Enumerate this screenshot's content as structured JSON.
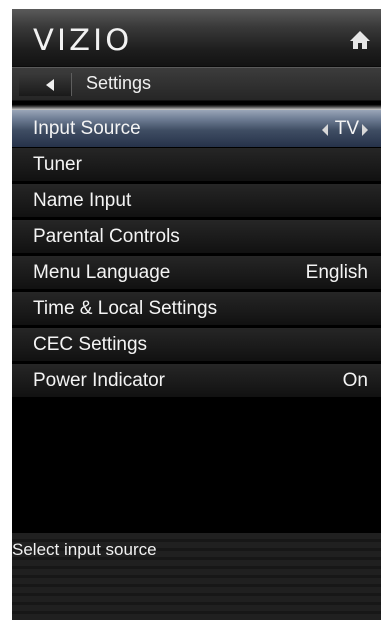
{
  "header": {
    "brand": "VIZIO",
    "home_icon": "home-icon"
  },
  "breadcrumb": {
    "back_icon": "back-arrow-icon",
    "title": "Settings"
  },
  "menu": {
    "items": [
      {
        "label": "Input Source",
        "value": "TV",
        "selected": true
      },
      {
        "label": "Tuner",
        "value": ""
      },
      {
        "label": "Name Input",
        "value": ""
      },
      {
        "label": "Parental Controls",
        "value": ""
      },
      {
        "label": "Menu Language",
        "value": "English"
      },
      {
        "label": "Time & Local Settings",
        "value": ""
      },
      {
        "label": "CEC Settings",
        "value": ""
      },
      {
        "label": "Power Indicator",
        "value": "On"
      }
    ]
  },
  "status": {
    "hint": "Select input source"
  }
}
